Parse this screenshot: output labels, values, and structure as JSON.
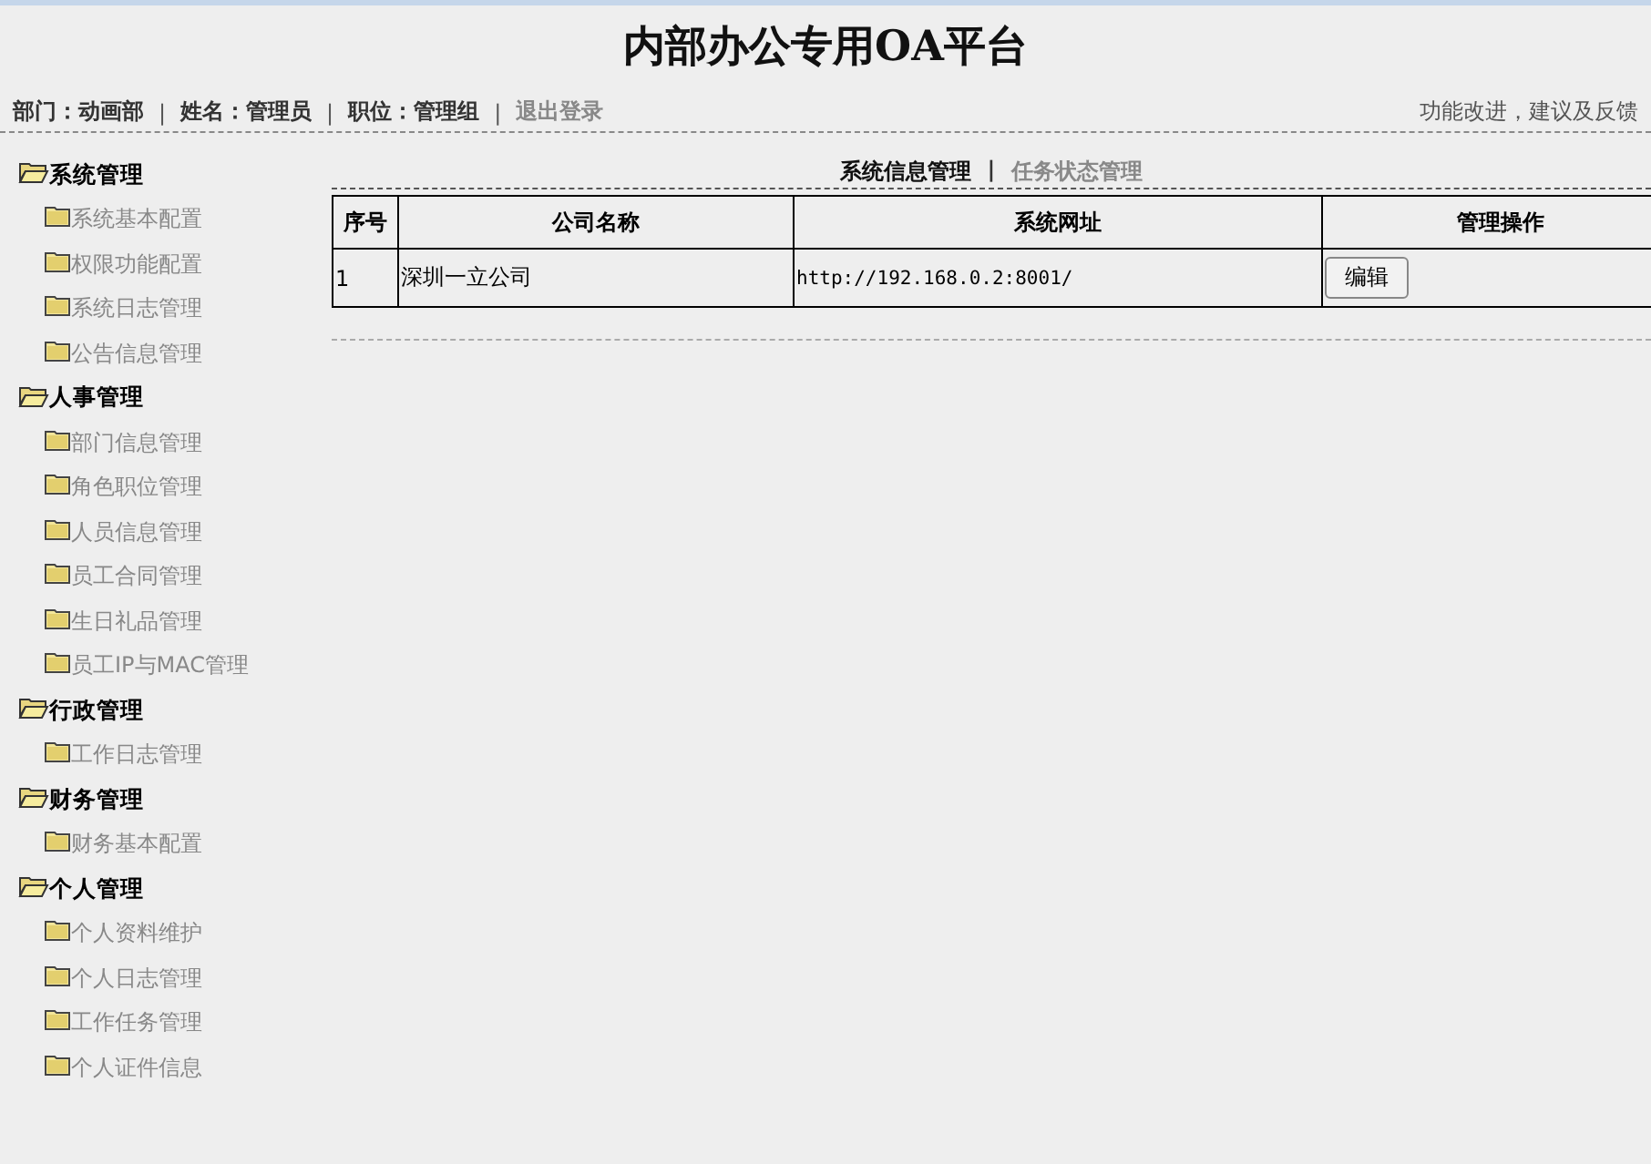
{
  "header": {
    "title": "内部办公专用OA平台"
  },
  "user_bar": {
    "fields": [
      {
        "label": "部门：",
        "value": "动画部"
      },
      {
        "label": "姓名：",
        "value": "管理员"
      },
      {
        "label": "职位：",
        "value": "管理组"
      }
    ],
    "separator": "|",
    "logout": "退出登录",
    "feedback": "功能改进，建议及反馈"
  },
  "sidebar": {
    "groups": [
      {
        "label": "系统管理",
        "expanded": true,
        "children": [
          {
            "label": "系统基本配置"
          },
          {
            "label": "权限功能配置"
          },
          {
            "label": "系统日志管理"
          },
          {
            "label": "公告信息管理"
          }
        ]
      },
      {
        "label": "人事管理",
        "expanded": true,
        "children": [
          {
            "label": "部门信息管理"
          },
          {
            "label": "角色职位管理"
          },
          {
            "label": "人员信息管理"
          },
          {
            "label": "员工合同管理"
          },
          {
            "label": "生日礼品管理"
          },
          {
            "label": "员工IP与MAC管理"
          }
        ]
      },
      {
        "label": "行政管理",
        "expanded": true,
        "children": [
          {
            "label": "工作日志管理"
          }
        ]
      },
      {
        "label": "财务管理",
        "expanded": true,
        "children": [
          {
            "label": "财务基本配置"
          }
        ]
      },
      {
        "label": "个人管理",
        "expanded": true,
        "children": [
          {
            "label": "个人资料维护"
          },
          {
            "label": "个人日志管理"
          },
          {
            "label": "工作任务管理"
          },
          {
            "label": "个人证件信息"
          }
        ]
      }
    ]
  },
  "tabs": [
    {
      "label": "系统信息管理",
      "selected": true
    },
    {
      "label": "任务状态管理",
      "selected": false
    }
  ],
  "tab_separator": "|",
  "table": {
    "columns": [
      "序号",
      "公司名称",
      "系统网址",
      "管理操作"
    ],
    "rows": [
      {
        "index": "1",
        "company": "深圳一立公司",
        "url": "http://192.168.0.2:8001/",
        "action": "编辑"
      }
    ]
  }
}
